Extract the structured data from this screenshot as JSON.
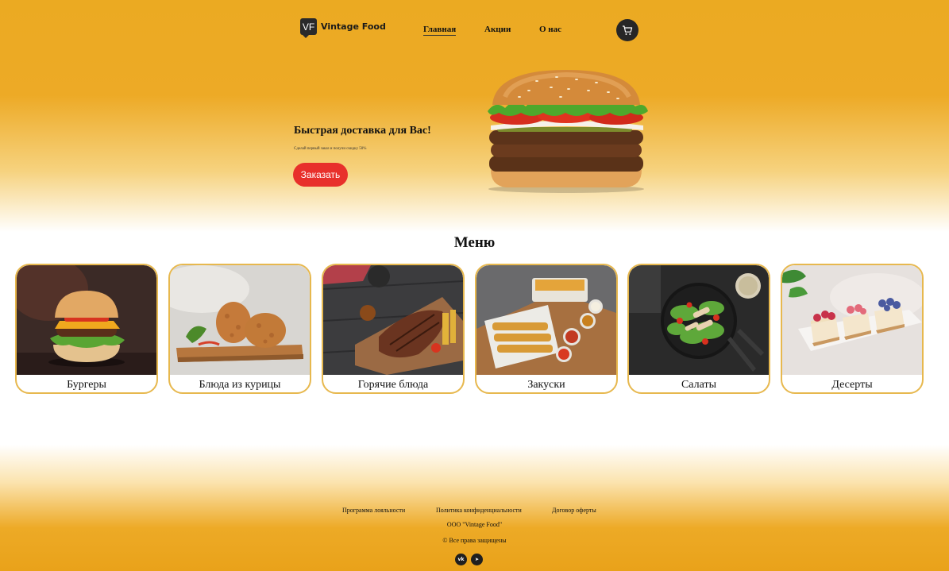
{
  "header": {
    "logo_mark": "VF",
    "logo_text": "Vintage Food",
    "nav": [
      "Главная",
      "Акции",
      "О нас"
    ],
    "cart_icon": "cart-icon"
  },
  "hero": {
    "title": "Быстрая доставка для Вас!",
    "subtitle": "Сделай первый заказ и получи скидку 50%",
    "order_label": "Заказать"
  },
  "menu": {
    "title": "Меню",
    "items": [
      {
        "label": "Бургеры"
      },
      {
        "label": "Блюда из курицы"
      },
      {
        "label": "Горячие блюда"
      },
      {
        "label": "Закуски"
      },
      {
        "label": "Салаты"
      },
      {
        "label": "Десерты"
      }
    ]
  },
  "footer": {
    "links": [
      "Программа лояльности",
      "Политика конфиденциальности",
      "Договор оферты"
    ],
    "company": "ООО \"Vintage Food\"",
    "rights": "© Все права защищены",
    "social": [
      {
        "icon": "vk-icon",
        "glyph": "vk"
      },
      {
        "icon": "telegram-icon",
        "glyph": "➤"
      }
    ]
  },
  "colors": {
    "accent_orange": "#EBAA22",
    "button_red": "#E8302B",
    "card_border": "#E7B84E",
    "dark": "#262626"
  }
}
